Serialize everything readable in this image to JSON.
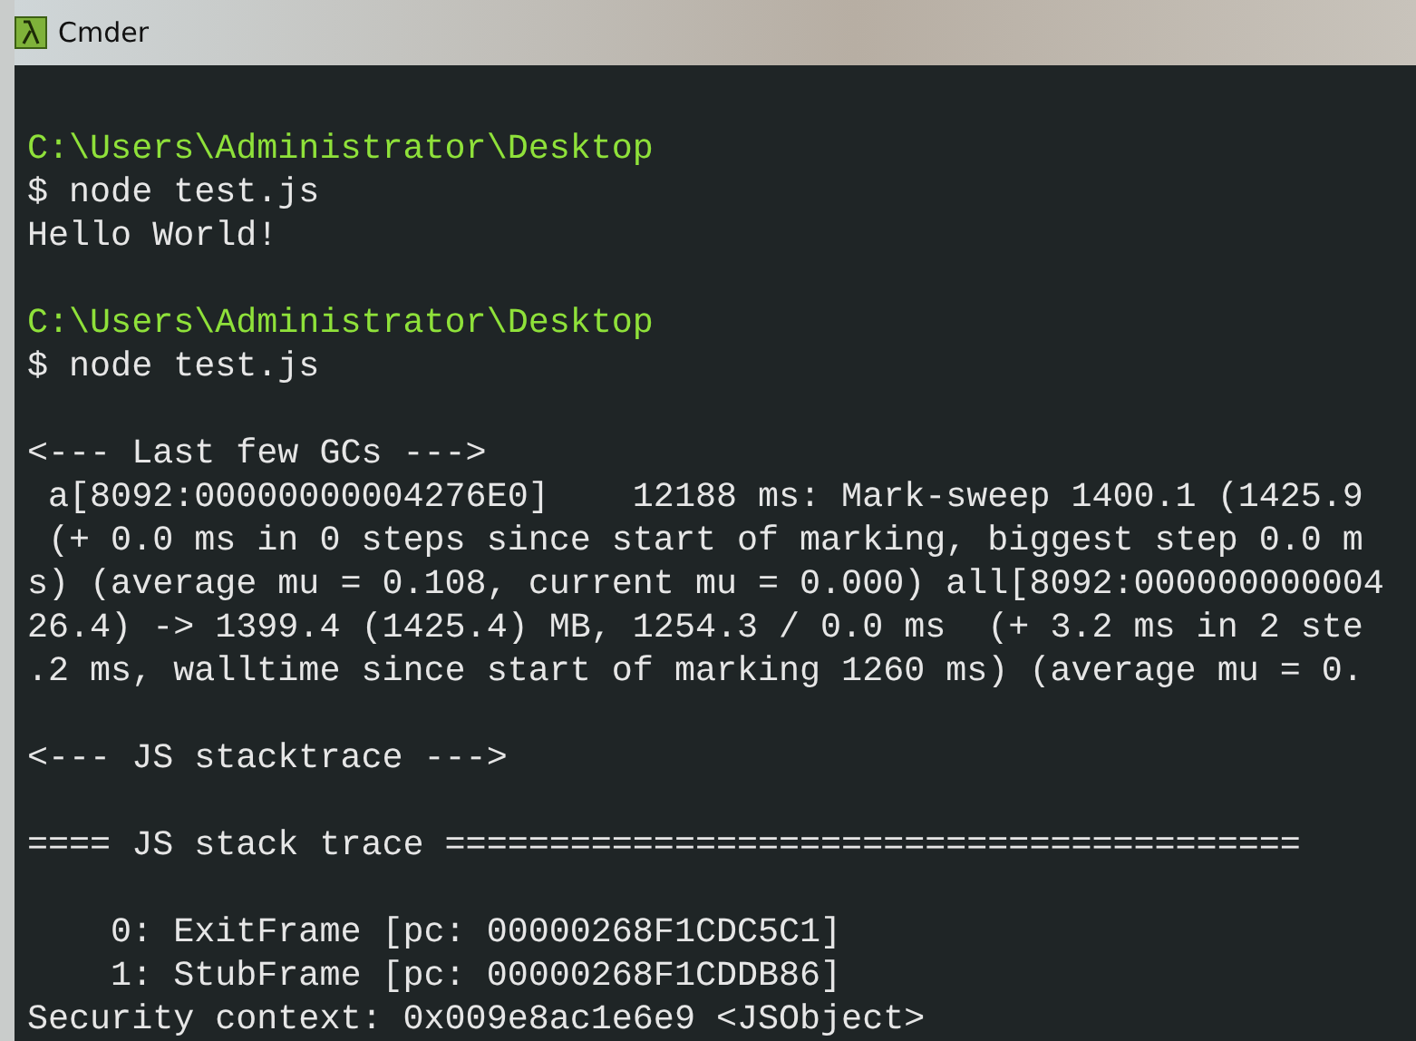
{
  "window": {
    "title": "Cmder"
  },
  "lines": [
    {
      "kind": "blank"
    },
    {
      "kind": "path",
      "text": "C:\\Users\\Administrator\\Desktop"
    },
    {
      "kind": "output",
      "text": "$ node test.js"
    },
    {
      "kind": "output",
      "text": "Hello World!"
    },
    {
      "kind": "blank"
    },
    {
      "kind": "path",
      "text": "C:\\Users\\Administrator\\Desktop"
    },
    {
      "kind": "output",
      "text": "$ node test.js"
    },
    {
      "kind": "blank"
    },
    {
      "kind": "output",
      "text": "<--- Last few GCs --->"
    },
    {
      "kind": "output",
      "text": " a[8092:00000000004276E0]    12188 ms: Mark-sweep 1400.1 (1425.9"
    },
    {
      "kind": "output",
      "text": " (+ 0.0 ms in 0 steps since start of marking, biggest step 0.0 m"
    },
    {
      "kind": "output",
      "text": "s) (average mu = 0.108, current mu = 0.000) all[8092:000000000004"
    },
    {
      "kind": "output",
      "text": "26.4) -> 1399.4 (1425.4) MB, 1254.3 / 0.0 ms  (+ 3.2 ms in 2 ste"
    },
    {
      "kind": "output",
      "text": ".2 ms, walltime since start of marking 1260 ms) (average mu = 0."
    },
    {
      "kind": "blank"
    },
    {
      "kind": "output",
      "text": "<--- JS stacktrace --->"
    },
    {
      "kind": "blank"
    },
    {
      "kind": "output",
      "text": "==== JS stack trace ========================================="
    },
    {
      "kind": "blank"
    },
    {
      "kind": "output",
      "text": "    0: ExitFrame [pc: 00000268F1CDC5C1]"
    },
    {
      "kind": "output",
      "text": "    1: StubFrame [pc: 00000268F1CDDB86]"
    },
    {
      "kind": "output",
      "text": "Security context: 0x009e8ac1e6e9 <JSObject>"
    }
  ]
}
